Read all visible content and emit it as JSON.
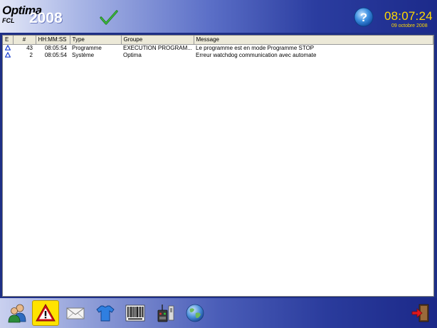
{
  "header": {
    "brand_name": "Optima",
    "brand_sub": "FCL",
    "brand_year": "2008",
    "status_icon": "check-icon",
    "help_icon": "help-icon",
    "clock_time": "08:07:24",
    "clock_date": "09 octobre 2008",
    "time_color": "#ffd800"
  },
  "log": {
    "columns": [
      "E",
      "#",
      "HH:MM:SS",
      "Type",
      "Groupe",
      "Message"
    ],
    "rows": [
      {
        "icon": "warning-triangle-icon",
        "num": "43",
        "time": "08:05:54",
        "type": "Programme",
        "group": "EXECUTION PROGRAM...",
        "message": "Le programme est en mode Programme STOP"
      },
      {
        "icon": "warning-triangle-icon",
        "num": "2",
        "time": "08:05:54",
        "type": "Système",
        "group": "Optima",
        "message": "Erreur watchdog communication avec automate"
      }
    ]
  },
  "toolbar": {
    "buttons": [
      {
        "name": "operators-icon",
        "active": false
      },
      {
        "name": "alarm-warning-icon",
        "active": true
      },
      {
        "name": "mail-icon",
        "active": false
      },
      {
        "name": "tshirt-icon",
        "active": false
      },
      {
        "name": "barcode-icon",
        "active": false
      },
      {
        "name": "remote-control-icon",
        "active": false
      },
      {
        "name": "globe-icon",
        "active": false
      },
      {
        "name": "exit-door-icon",
        "active": false
      }
    ],
    "active_color": "#ffe300"
  }
}
